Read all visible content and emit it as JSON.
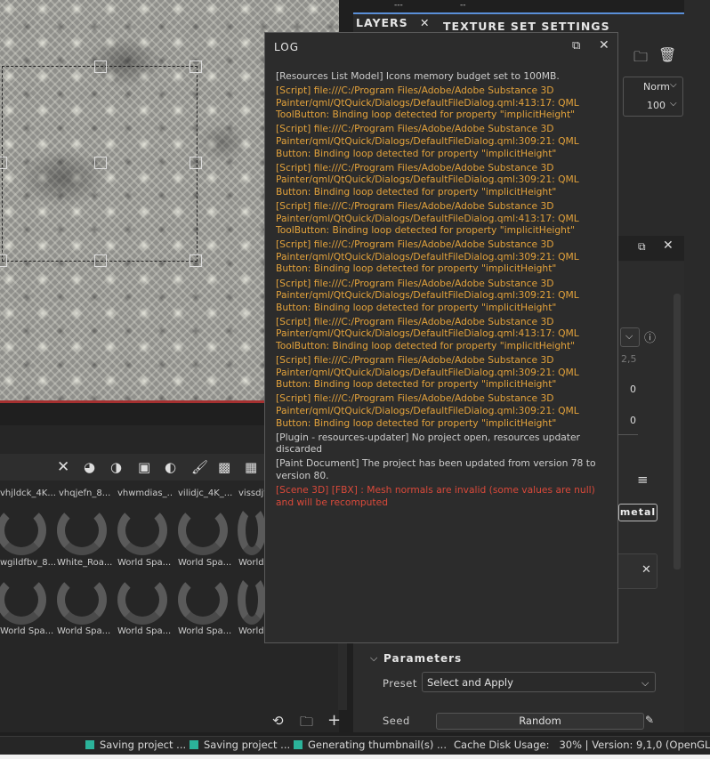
{
  "viewport": {},
  "layers_panel": {
    "top_strip_text": "---",
    "top_strip_text2": "--",
    "tabs": [
      {
        "label": "LAYERS"
      },
      {
        "label": "TEXTURE SET SETTINGS"
      }
    ],
    "blend_mode": "Norm",
    "opacity": "100"
  },
  "properties_panel": {
    "field_25": "2,5",
    "field_a": "0",
    "field_b": "0",
    "tag": "metal",
    "parameters_heading": "Parameters",
    "preset_label": "Preset",
    "preset_value": "Select and Apply",
    "seed_label": "Seed",
    "seed_button": "Random"
  },
  "assets": {
    "row1": [
      {
        "name": "vhjldck_4K..."
      },
      {
        "name": "vhqjefn_8..."
      },
      {
        "name": "vhwmdias_..."
      },
      {
        "name": "vilidjc_4K_..."
      },
      {
        "name": "vissdjf..."
      }
    ],
    "row2": [
      {
        "name": "wgildfbv_8..."
      },
      {
        "name": "White_Roa..."
      },
      {
        "name": "World Spa..."
      },
      {
        "name": "World Spa..."
      },
      {
        "name": "World"
      }
    ],
    "row3": [
      {
        "name": "World Spa..."
      },
      {
        "name": "World Spa..."
      },
      {
        "name": "World Spa..."
      },
      {
        "name": "World Spa..."
      },
      {
        "name": "World"
      }
    ]
  },
  "log": {
    "title": "LOG",
    "entries": [
      {
        "level": "info",
        "text": "[Resources List Model] Icons memory budget set to 100MB."
      },
      {
        "level": "warn",
        "text": "[Script] file:///C:/Program Files/Adobe/Adobe Substance 3D Painter/qml/QtQuick/Dialogs/DefaultFileDialog.qml:413:17: QML ToolButton: Binding loop detected for property \"implicitHeight\""
      },
      {
        "level": "warn",
        "text": "[Script] file:///C:/Program Files/Adobe/Adobe Substance 3D Painter/qml/QtQuick/Dialogs/DefaultFileDialog.qml:309:21: QML Button: Binding loop detected for property \"implicitHeight\""
      },
      {
        "level": "warn",
        "text": "[Script] file:///C:/Program Files/Adobe/Adobe Substance 3D Painter/qml/QtQuick/Dialogs/DefaultFileDialog.qml:309:21: QML Button: Binding loop detected for property \"implicitHeight\""
      },
      {
        "level": "warn",
        "text": "[Script] file:///C:/Program Files/Adobe/Adobe Substance 3D Painter/qml/QtQuick/Dialogs/DefaultFileDialog.qml:413:17: QML ToolButton: Binding loop detected for property \"implicitHeight\""
      },
      {
        "level": "warn",
        "text": "[Script] file:///C:/Program Files/Adobe/Adobe Substance 3D Painter/qml/QtQuick/Dialogs/DefaultFileDialog.qml:309:21: QML Button: Binding loop detected for property \"implicitHeight\""
      },
      {
        "level": "warn",
        "text": "[Script] file:///C:/Program Files/Adobe/Adobe Substance 3D Painter/qml/QtQuick/Dialogs/DefaultFileDialog.qml:309:21: QML Button: Binding loop detected for property \"implicitHeight\""
      },
      {
        "level": "warn",
        "text": "[Script] file:///C:/Program Files/Adobe/Adobe Substance 3D Painter/qml/QtQuick/Dialogs/DefaultFileDialog.qml:413:17: QML ToolButton: Binding loop detected for property \"implicitHeight\""
      },
      {
        "level": "warn",
        "text": "[Script] file:///C:/Program Files/Adobe/Adobe Substance 3D Painter/qml/QtQuick/Dialogs/DefaultFileDialog.qml:309:21: QML Button: Binding loop detected for property \"implicitHeight\""
      },
      {
        "level": "warn",
        "text": "[Script] file:///C:/Program Files/Adobe/Adobe Substance 3D Painter/qml/QtQuick/Dialogs/DefaultFileDialog.qml:309:21: QML Button: Binding loop detected for property \"implicitHeight\""
      },
      {
        "level": "info",
        "text": "[Plugin - resources-updater] No project open, resources updater discarded"
      },
      {
        "level": "info",
        "text": "[Paint Document] The project has been updated from version 78 to version 80."
      },
      {
        "level": "error",
        "text": "[Scene 3D] [FBX] : Mesh normals are invalid (some values are null) and will be recomputed"
      }
    ]
  },
  "status_bar": {
    "jobs": [
      {
        "label": "Saving project ..."
      },
      {
        "label": "Saving project ..."
      },
      {
        "label": "Generating thumbnail(s) ..."
      }
    ],
    "cache_label": "Cache Disk Usage:",
    "cache_value": "30%",
    "version": "| Version: 9,1,0 (OpenGL)"
  },
  "colors": {
    "warn": "#e3a23b",
    "error": "#d9493a",
    "info": "#cdcdcd",
    "accent": "#6d9ae6",
    "status_dot": "#2bb39a"
  },
  "icons": [
    "close-icon",
    "dock-icon",
    "folder-icon",
    "trash-icon",
    "info-icon",
    "chevron-down-icon",
    "refresh-icon",
    "add-icon",
    "pencil-icon"
  ]
}
